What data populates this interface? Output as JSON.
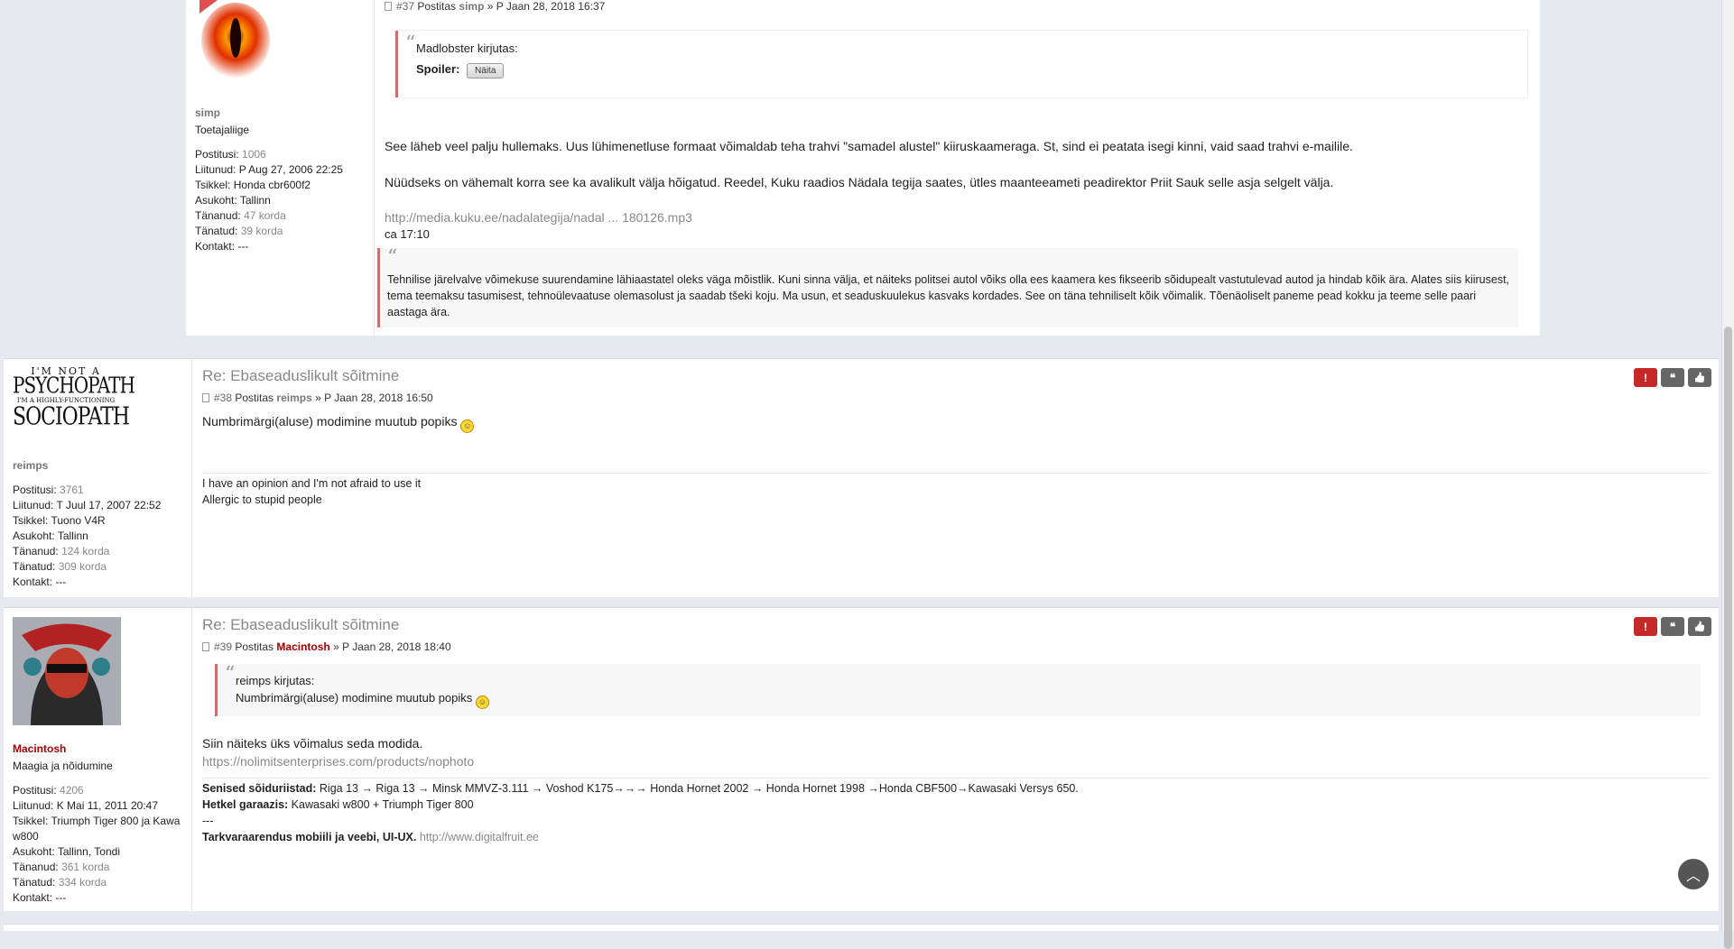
{
  "post37": {
    "meta_num": "#37",
    "meta_postitas": "Postitas",
    "meta_user": "simp",
    "meta_date": "» P Jaan 28, 2018 16:37",
    "profile": {
      "name": "simp",
      "rank": "Toetajaliige",
      "stats": [
        {
          "label": "Postitusi:",
          "value": "1006"
        },
        {
          "label": "Liitunud:",
          "value": "P Aug 27, 2006 22:25"
        },
        {
          "label": "Tsikkel:",
          "value": "Honda cbr600f2"
        },
        {
          "label": "Asukoht:",
          "value": "Tallinn"
        },
        {
          "label": "Tänanud:",
          "value": "47 korda"
        },
        {
          "label": "Tänatud:",
          "value": "39 korda"
        },
        {
          "label": "Kontakt:",
          "value": "---"
        }
      ]
    },
    "quote_author": "Madlobster kirjutas:",
    "spoiler_label": "Spoiler:",
    "spoiler_button": "Näita",
    "para1": "See läheb veel palju hullemaks. Uus lühimenetluse formaat võimaldab teha trahvi \"samadel alustel\" kiiruskaameraga. St, sind ei peatata isegi kinni, vaid saad trahvi e-mailile.",
    "para2": "Nüüdseks on vähemalt korra see ka avalikult välja hõigatud. Reedel, Kuku raadios Nädala tegija saates, ütles maanteeameti peadirektor Priit Sauk selle asja selgelt välja.",
    "link": "http://media.kuku.ee/nadalategija/nadal ... 180126.mp3",
    "time": "ca 17:10",
    "quote2": "Tehnilise järelvalve võimekuse suurendamine lähiaastatel oleks väga mõistlik. Kuni sinna välja, et näiteks politsei autol võiks olla ees kaamera kes fikseerib sõidupealt vastutulevad autod ja hindab kõik ära. Alates siis kiirusest, tema teemaksu tasumisest, tehnoülevaatuse olemasolust ja saadab tšeki koju. Ma usun, et seaduskuulekus kasvaks kordades. See on täna tehniliselt kõik võimalik. Tõenäoliselt paneme pead kokku ja teeme selle paari aastaga ära."
  },
  "post38": {
    "title": "Re: Ebaseaduslikult sõitmine",
    "meta_num": "#38",
    "meta_postitas": "Postitas",
    "meta_user": "reimps",
    "meta_date": "» P Jaan 28, 2018 16:50",
    "avatar_lines": [
      "I'M NOT A",
      "PSYCHOPATH",
      "I'M A HIGHLY-FUNCTIONING",
      "SOCIOPATH"
    ],
    "profile": {
      "name": "reimps",
      "stats": [
        {
          "label": "Postitusi:",
          "value": "3761"
        },
        {
          "label": "Liitunud:",
          "value": "T Juul 17, 2007 22:52"
        },
        {
          "label": "Tsikkel:",
          "value": "Tuono V4R"
        },
        {
          "label": "Asukoht:",
          "value": "Tallinn"
        },
        {
          "label": "Tänanud:",
          "value": "124 korda"
        },
        {
          "label": "Tänatud:",
          "value": "309 korda"
        },
        {
          "label": "Kontakt:",
          "value": "---"
        }
      ]
    },
    "text": "Numbrimärgi(aluse) modimine muutub popiks",
    "sig1": "I have an opinion and I'm not afraid to use it",
    "sig2": "Allergic to stupid people"
  },
  "post39": {
    "title": "Re: Ebaseaduslikult sõitmine",
    "meta_num": "#39",
    "meta_postitas": "Postitas",
    "meta_user": "Macintosh",
    "meta_date": "» P Jaan 28, 2018 18:40",
    "profile": {
      "name": "Macintosh",
      "rank": "Maagia ja nõidumine",
      "stats": [
        {
          "label": "Postitusi:",
          "value": "4206"
        },
        {
          "label": "Liitunud:",
          "value": "K Mai 11, 2011 20:47"
        },
        {
          "label": "Tsikkel:",
          "value": "Triumph Tiger 800 ja Kawa w800"
        },
        {
          "label": "Asukoht:",
          "value": "Tallinn, Tondi"
        },
        {
          "label": "Tänanud:",
          "value": "361 korda"
        },
        {
          "label": "Tänatud:",
          "value": "334 korda"
        },
        {
          "label": "Kontakt:",
          "value": "---"
        }
      ]
    },
    "quote_author": "reimps kirjutas:",
    "quote_text": "Numbrimärgi(aluse) modimine muutub popiks",
    "text": "Siin näiteks üks võimalus seda modida.",
    "link": "https://nolimitsenterprises.com/products/nophoto",
    "sig_label1": "Senised sõiduriistad:",
    "sig_text1": "Riga 13 → Riga 13 → Minsk MMVZ-3.111 → Voshod K175→→→ Honda Hornet 2002 → Honda Hornet 1998 →Honda CBF500→Kawasaki Versys 650.",
    "sig_label2": "Hetkel garaazis:",
    "sig_text2": "Kawasaki w800 + Triumph Tiger 800",
    "sig_dashes": "---",
    "sig_label3": "Tarkvaraarendus mobiili ja veebi, UI-UX.",
    "sig_link": "http://www.digitalfruit.ee"
  },
  "buttons": {
    "report": "!",
    "quote": "❝",
    "thanks": "👍"
  },
  "colors": {
    "accent_red": "#aa0000",
    "quote_border": "#c97070",
    "button_gray": "#666666",
    "report_red": "#c62828"
  }
}
